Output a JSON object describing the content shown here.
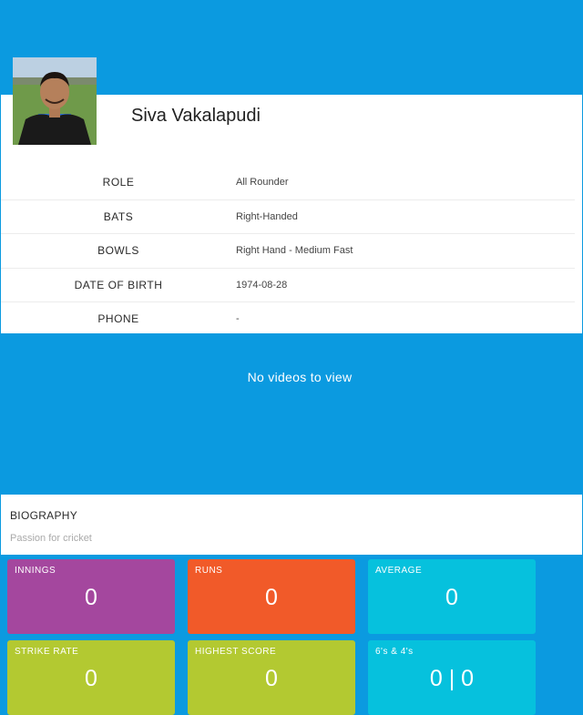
{
  "player": {
    "name": "Siva Vakalapudi",
    "details": [
      {
        "label": "ROLE",
        "value": "All Rounder"
      },
      {
        "label": "BATS",
        "value": "Right-Handed"
      },
      {
        "label": "BOWLS",
        "value": "Right Hand - Medium Fast"
      },
      {
        "label": "DATE OF BIRTH",
        "value": "1974-08-28"
      },
      {
        "label": "PHONE",
        "value": "-"
      }
    ]
  },
  "videos": {
    "empty_text": "No videos to view"
  },
  "biography": {
    "title": "BIOGRAPHY",
    "text": "Passion for cricket"
  },
  "stats": [
    {
      "label": "INNINGS",
      "value": "0",
      "color": "#a4479e"
    },
    {
      "label": "RUNS",
      "value": "0",
      "color": "#f15a29"
    },
    {
      "label": "AVERAGE",
      "value": "0",
      "color": "#06c1dd"
    },
    {
      "label": "STRIKE RATE",
      "value": "0",
      "color": "#b3c931"
    },
    {
      "label": "HIGHEST SCORE",
      "value": "0",
      "color": "#b3c931"
    },
    {
      "label": "6's & 4's",
      "value": "0 | 0",
      "color": "#06c1dd"
    }
  ]
}
